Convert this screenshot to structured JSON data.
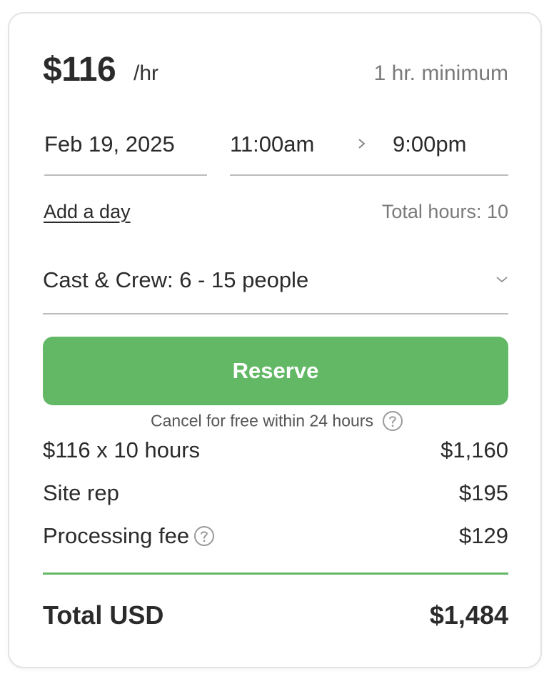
{
  "pricing": {
    "rate": "$116",
    "unit": "/hr",
    "minimum": "1 hr. minimum"
  },
  "booking": {
    "date": "Feb 19, 2025",
    "start_time": "11:00am",
    "end_time": "9:00pm",
    "add_day_label": "Add a day",
    "total_hours": "Total hours: 10"
  },
  "attendees": {
    "selected": "Cast & Crew: 6 - 15 people"
  },
  "reserve": {
    "label": "Reserve",
    "cancel_note": "Cancel for free within 24 hours"
  },
  "breakdown": [
    {
      "label": "$116 x 10 hours",
      "amount": "$1,160"
    },
    {
      "label": "Site rep",
      "amount": "$195"
    },
    {
      "label": "Processing fee",
      "amount": "$129"
    }
  ],
  "total": {
    "label": "Total USD",
    "amount": "$1,484"
  },
  "colors": {
    "accent": "#62b865",
    "text": "#2b2b2b",
    "muted": "#7a7a7a",
    "border": "#bcbcbc"
  },
  "icons": {
    "help": "help-circle-icon",
    "arrow": "chevron-right-icon",
    "dropdown": "chevron-down-icon"
  }
}
